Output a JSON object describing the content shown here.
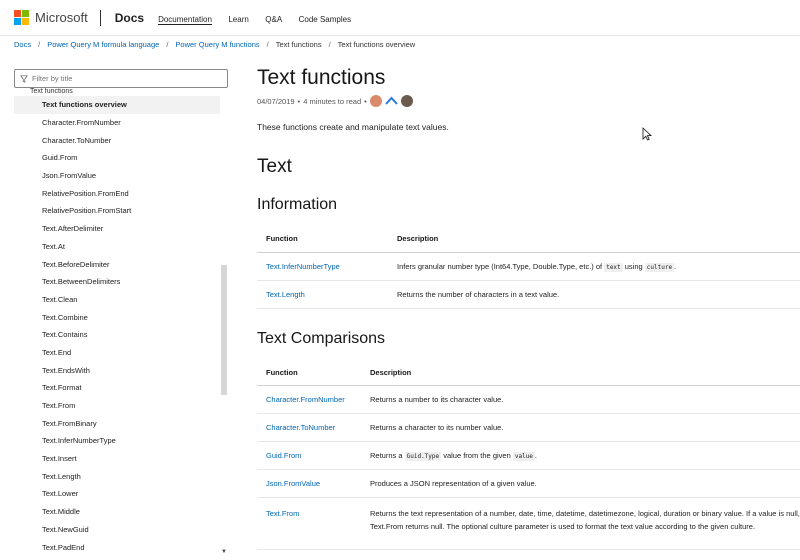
{
  "header": {
    "brand": "Microsoft",
    "product": "Docs",
    "nav": [
      "Documentation",
      "Learn",
      "Q&A",
      "Code Samples"
    ],
    "logo_colors": [
      "#f25022",
      "#7fba00",
      "#00a4ef",
      "#ffb900"
    ]
  },
  "breadcrumb": [
    "Docs",
    "Power Query M formula language",
    "Power Query M functions",
    "Text functions",
    "Text functions overview"
  ],
  "sidebar": {
    "filter_placeholder": "Filter by title",
    "parent_cut": "Text functions",
    "items": [
      "Text functions overview",
      "Character.FromNumber",
      "Character.ToNumber",
      "Guid.From",
      "Json.FromValue",
      "RelativePosition.FromEnd",
      "RelativePosition.FromStart",
      "Text.AfterDelimiter",
      "Text.At",
      "Text.BeforeDelimiter",
      "Text.BetweenDelimiters",
      "Text.Clean",
      "Text.Combine",
      "Text.Contains",
      "Text.End",
      "Text.EndsWith",
      "Text.Format",
      "Text.From",
      "Text.FromBinary",
      "Text.InferNumberType",
      "Text.Insert",
      "Text.Length",
      "Text.Lower",
      "Text.Middle",
      "Text.NewGuid",
      "Text.PadEnd"
    ]
  },
  "main": {
    "title": "Text functions",
    "date": "04/07/2019",
    "read_time": "4 minutes to read",
    "lead": "These functions create and manipulate text values.",
    "section": "Text",
    "info_heading": "Information",
    "col_function": "Function",
    "col_description": "Description",
    "info_rows": [
      {
        "fn": "Text.InferNumberType",
        "pre": "Infers granular number type (Int64.Type, Double.Type, etc.) of ",
        "code1": "text",
        "mid": " using ",
        "code2": "culture",
        "post": "."
      },
      {
        "fn": "Text.Length",
        "desc": "Returns the number of characters in a text value."
      }
    ],
    "cmp_heading": "Text Comparisons",
    "cmp_rows": [
      {
        "fn": "Character.FromNumber",
        "desc": "Returns a number to its character value."
      },
      {
        "fn": "Character.ToNumber",
        "desc": "Returns a character to its number value."
      },
      {
        "fn": "Guid.From",
        "pre": "Returns a ",
        "code1": "Guid.Type",
        "mid": " value from the given ",
        "code2": "value",
        "post": "."
      },
      {
        "fn": "Json.FromValue",
        "desc": "Produces a JSON representation of a given value."
      },
      {
        "fn": "Text.From",
        "desc": "Returns the text representation of a number, date, time, datetime, datetimezone, logical, duration or binary value. If a value is null, Text.From returns null. The optional culture parameter is used to format the text value according to the given culture."
      }
    ]
  }
}
